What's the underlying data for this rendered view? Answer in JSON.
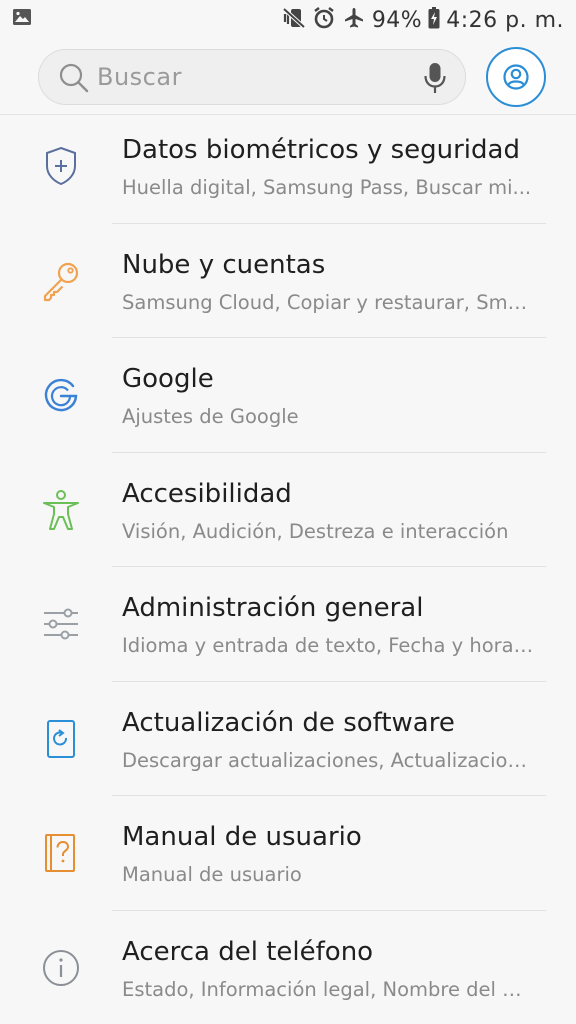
{
  "status_bar": {
    "left_icon": "image-icon",
    "icons": [
      "vibrate-mute-icon",
      "alarm-icon",
      "airplane-icon"
    ],
    "battery_percent": "94%",
    "time": "4:26 p. m."
  },
  "search": {
    "placeholder": "Buscar"
  },
  "colors": {
    "accent": "#2a8ed6",
    "security": "#5b6f9e",
    "cloud": "#f0a24f",
    "google": "#3b82d6",
    "accessibility": "#6cbf57",
    "general": "#9aa0a6",
    "software": "#2b8fd8",
    "manual": "#e58e32",
    "about": "#8a9096"
  },
  "settings": {
    "items": [
      {
        "title": "Datos biométricos y seguridad",
        "subtitle": "Huella digital, Samsung Pass, Buscar mi...",
        "icon": "shield-icon"
      },
      {
        "title": "Nube y cuentas",
        "subtitle": "Samsung Cloud, Copiar y restaurar, Smar...",
        "icon": "key-icon"
      },
      {
        "title": "Google",
        "subtitle": "Ajustes de Google",
        "icon": "google-icon"
      },
      {
        "title": "Accesibilidad",
        "subtitle": "Visión, Audición, Destreza e interacción",
        "icon": "accessibility-icon"
      },
      {
        "title": "Administración general",
        "subtitle": "Idioma y entrada de texto, Fecha y hora,...",
        "icon": "sliders-icon"
      },
      {
        "title": "Actualización de software",
        "subtitle": "Descargar actualizaciones, Actualizacion...",
        "icon": "software-update-icon"
      },
      {
        "title": "Manual de usuario",
        "subtitle": "Manual de usuario",
        "icon": "user-manual-icon"
      },
      {
        "title": "Acerca del teléfono",
        "subtitle": "Estado, Información legal, Nombre del di...",
        "icon": "info-icon"
      }
    ]
  }
}
